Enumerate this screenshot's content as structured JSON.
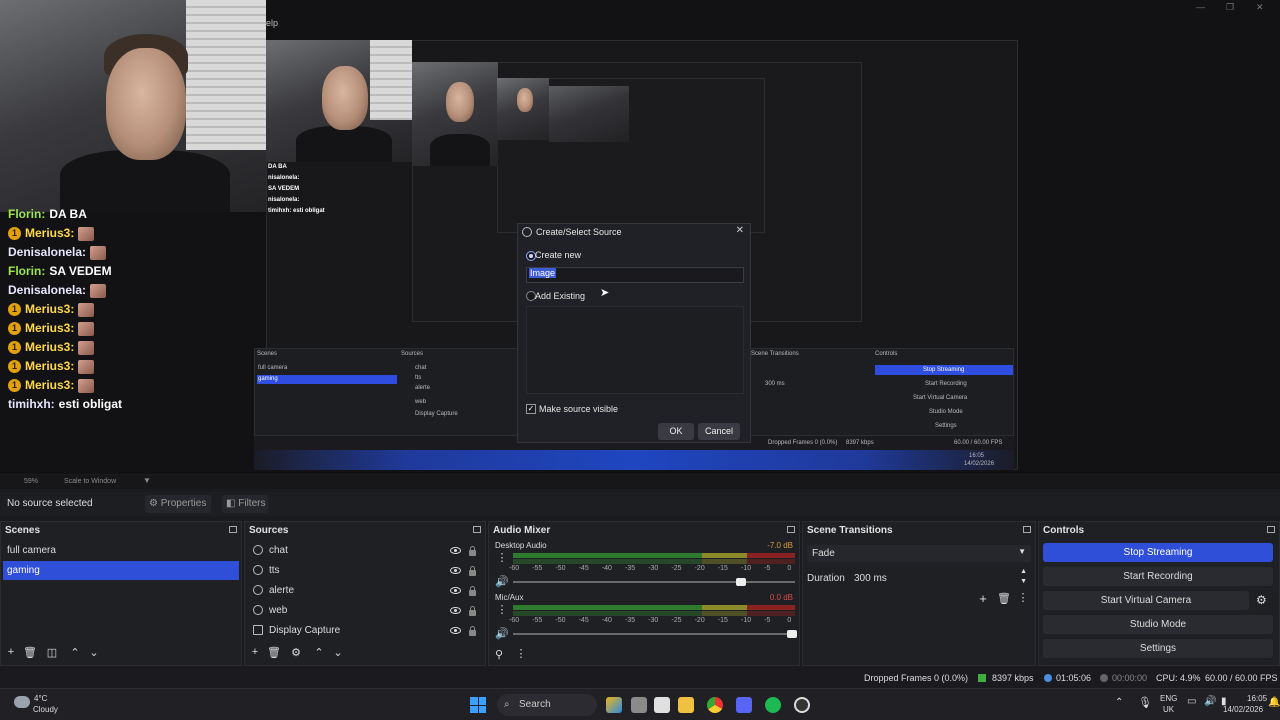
{
  "app": {
    "menu_fragment": "elp",
    "window_buttons": [
      "—",
      "❐",
      "✕"
    ]
  },
  "preview": {
    "chat": [
      {
        "name": "Florin:",
        "text": "DA BA",
        "badge": false,
        "emote": false,
        "color": "n-green"
      },
      {
        "name": "Merius3:",
        "text": "",
        "badge": true,
        "emote": true,
        "color": "n-yellow"
      },
      {
        "name": "Denisalonela:",
        "text": "",
        "badge": false,
        "emote": true,
        "color": "n-lav"
      },
      {
        "name": "Florin:",
        "text": "SA VEDEM",
        "badge": false,
        "emote": false,
        "color": "n-green"
      },
      {
        "name": "Denisalonela:",
        "text": "",
        "badge": false,
        "emote": true,
        "color": "n-lav"
      },
      {
        "name": "Merius3:",
        "text": "",
        "badge": true,
        "emote": true,
        "color": "n-yellow"
      },
      {
        "name": "Merius3:",
        "text": "",
        "badge": true,
        "emote": true,
        "color": "n-yellow"
      },
      {
        "name": "Merius3:",
        "text": "",
        "badge": true,
        "emote": true,
        "color": "n-yellow"
      },
      {
        "name": "Merius3:",
        "text": "",
        "badge": true,
        "emote": true,
        "color": "n-yellow"
      },
      {
        "name": "Merius3:",
        "text": "",
        "badge": true,
        "emote": true,
        "color": "n-yellow"
      },
      {
        "name": "timihxh:",
        "text": "esti obligat",
        "badge": false,
        "emote": false,
        "color": "n-lav"
      }
    ],
    "mini_chat": [
      "DA BA",
      "nisalonela:",
      "SA VEDEM",
      "nisalonela:",
      "timihxh: esti obligat"
    ]
  },
  "dialog": {
    "title": "Create/Select Source",
    "close": "✕",
    "create_new": "Create new",
    "name_value": "Image",
    "add_existing": "Add Existing",
    "make_visible": "Make source visible",
    "ok": "OK",
    "cancel": "Cancel"
  },
  "scalebar": {
    "zoom": "59%",
    "mode": "Scale to Window"
  },
  "propsbar": {
    "no_source": "No source selected",
    "properties": "Properties",
    "filters": "Filters"
  },
  "scenes": {
    "title": "Scenes",
    "items": [
      "full camera",
      "gaming"
    ],
    "selected": 1
  },
  "sources": {
    "title": "Sources",
    "items": [
      "chat",
      "tts",
      "alerte",
      "web",
      "Display Capture"
    ]
  },
  "audio_mixer": {
    "title": "Audio Mixer",
    "scale": [
      "-60",
      "-55",
      "-50",
      "-45",
      "-40",
      "-35",
      "-30",
      "-25",
      "-20",
      "-15",
      "-10",
      "-5",
      "0"
    ],
    "channels": [
      {
        "name": "Desktop Audio",
        "db": "-7.0 dB",
        "db_color": "#d89a3a",
        "volume": 0.82
      },
      {
        "name": "Mic/Aux",
        "db": "0.0 dB",
        "db_color": "#d84a4a",
        "volume": 1.0
      }
    ]
  },
  "transitions": {
    "title": "Scene Transitions",
    "selected": "Fade",
    "duration_label": "Duration",
    "duration_value": "300 ms"
  },
  "controls": {
    "title": "Controls",
    "buttons": [
      "Stop Streaming",
      "Start Recording",
      "Start Virtual Camera",
      "Studio Mode",
      "Settings"
    ]
  },
  "status": {
    "dropped": "Dropped Frames 0 (0.0%)",
    "kbps": "8397 kbps",
    "stream_time": "01:05:06",
    "rec_time": "00:00:00",
    "cpu": "CPU: 4.9%",
    "fps": "60.00 / 60.00 FPS"
  },
  "taskbar": {
    "weather_temp": "4°C",
    "weather_desc": "Cloudy",
    "search": "Search",
    "lang1": "ENG",
    "lang2": "UK",
    "time": "16:05",
    "date": "14/02/2026"
  }
}
